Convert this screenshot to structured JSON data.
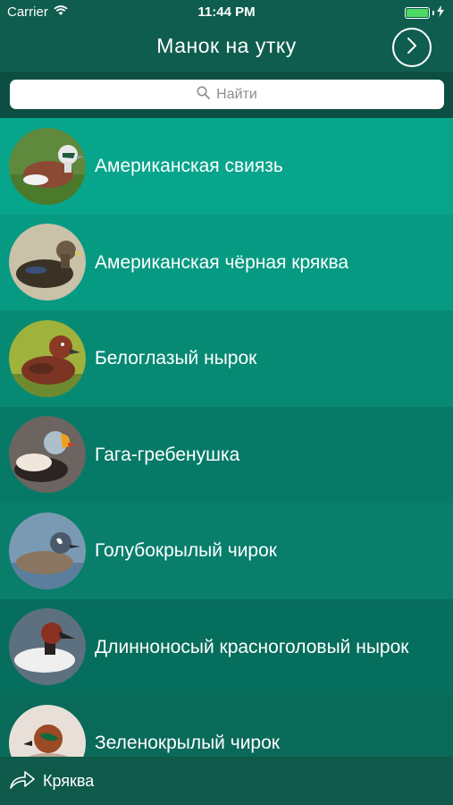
{
  "status_bar": {
    "carrier": "Carrier",
    "time": "11:44 PM",
    "icons": [
      "wifi-icon",
      "battery-icon",
      "charging-icon"
    ]
  },
  "nav": {
    "title": "Манок на утку",
    "next_icon": "chevron-right-circle-icon"
  },
  "search": {
    "placeholder": "Найти",
    "icon": "search-icon"
  },
  "ducks": [
    {
      "name": "Американская свиязь",
      "bg": "#07a58c"
    },
    {
      "name": "Американская чёрная кряква",
      "bg": "#079a82"
    },
    {
      "name": "Белоглазый нырок",
      "bg": "#078a74"
    },
    {
      "name": "Гага-гребенушка",
      "bg": "#067a67"
    },
    {
      "name": "Голубокрылый чирок",
      "bg": "#087e6b"
    },
    {
      "name": "Длинноносый красноголовый нырок",
      "bg": "#066e5d"
    },
    {
      "name": "Зеленокрылый чирок",
      "bg": "#0a6a5a"
    }
  ],
  "bottom_bar": {
    "share_icon": "share-arrow-icon",
    "selected_label": "Кряква"
  },
  "colors": {
    "nav_background": "#0f5d4e",
    "search_strip": "#0c4f42",
    "bottom_bar": "#0f5a4b"
  }
}
